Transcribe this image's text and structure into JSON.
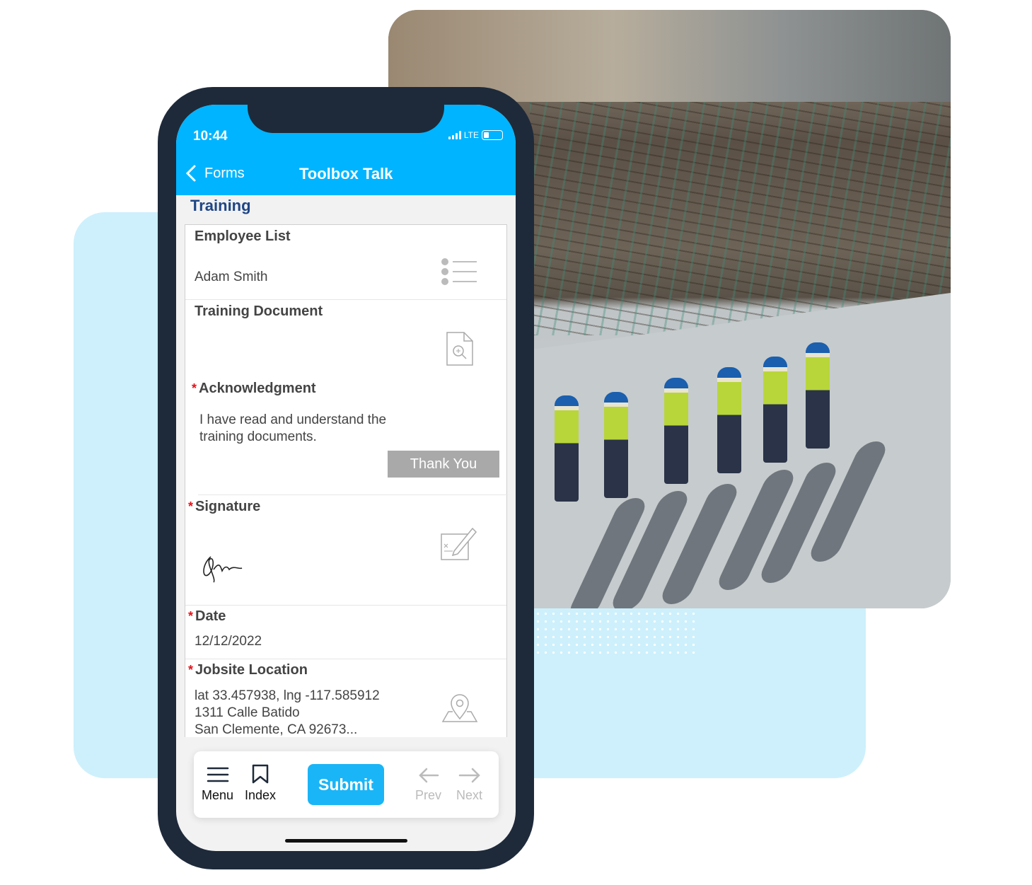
{
  "colors": {
    "accent": "#00b4ff",
    "submit": "#1ab5f7",
    "section_title": "#1f4585",
    "required": "#e2141b",
    "phone_frame": "#1e2a3a",
    "background_panel": "#cdf0fc"
  },
  "status_bar": {
    "time": "10:44",
    "network": "LTE"
  },
  "nav": {
    "back_label": "Forms",
    "title": "Toolbox Talk"
  },
  "section_title": "Training",
  "fields": {
    "employee_list": {
      "label": "Employee List",
      "value": "Adam Smith",
      "icon": "list-icon"
    },
    "training_document": {
      "label": "Training Document",
      "icon": "document-search-icon"
    },
    "acknowledgment": {
      "label": "Acknowledgment",
      "required": "*",
      "text": "I have read and understand the training documents.",
      "button": "Thank You"
    },
    "signature": {
      "label": "Signature",
      "required": "*",
      "icon": "signature-edit-icon"
    },
    "date": {
      "label": "Date",
      "required": "*",
      "value": "12/12/2022"
    },
    "jobsite_location": {
      "label": "Jobsite Location",
      "required": "*",
      "line1": "lat 33.457938, lng -117.585912",
      "line2": "1311 Calle Batido",
      "line3": "San Clemente, CA  92673...",
      "icon": "map-pin-icon"
    }
  },
  "bottom_bar": {
    "menu": "Menu",
    "index": "Index",
    "submit": "Submit",
    "prev": "Prev",
    "next": "Next"
  }
}
